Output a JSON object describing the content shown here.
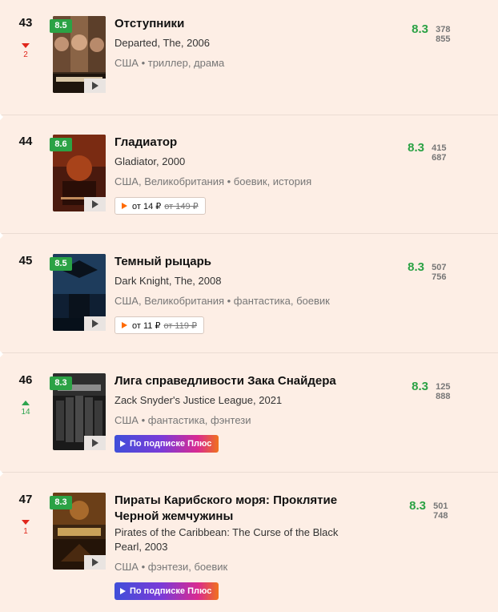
{
  "films": [
    {
      "rank": "43",
      "change": {
        "dir": "down",
        "value": "2"
      },
      "badge": "8.5",
      "title": "Отступники",
      "original": "Departed, The, 2006",
      "meta": "США • триллер, драма",
      "rating": "8.3",
      "votes": "378 855"
    },
    {
      "rank": "44",
      "change": null,
      "badge": "8.6",
      "title": "Гладиатор",
      "original": "Gladiator, 2000",
      "meta": "США, Великобритания • боевик, история",
      "rating": "8.3",
      "votes": "415 687",
      "price": {
        "from": "от 14 ₽",
        "old": "от 149 ₽"
      }
    },
    {
      "rank": "45",
      "change": null,
      "badge": "8.5",
      "title": "Темный рыцарь",
      "original": "Dark Knight, The, 2008",
      "meta": "США, Великобритания • фантастика, боевик",
      "rating": "8.3",
      "votes": "507 756",
      "price": {
        "from": "от 11 ₽",
        "old": "от 119 ₽"
      }
    },
    {
      "rank": "46",
      "change": {
        "dir": "up",
        "value": "14"
      },
      "badge": "8.3",
      "title": "Лига справедливости Зака Снайдера",
      "original": "Zack Snyder's Justice League, 2021",
      "meta": "США • фантастика, фэнтези",
      "rating": "8.3",
      "votes": "125 888",
      "plus": "По подписке Плюс"
    },
    {
      "rank": "47",
      "change": {
        "dir": "down",
        "value": "1"
      },
      "badge": "8.3",
      "title": "Пираты Карибского моря: Проклятие Черной жемчужины",
      "original": "Pirates of the Caribbean: The Curse of the Black Pearl, 2003",
      "meta": "США • фэнтези, боевик",
      "rating": "8.3",
      "votes": "501 748",
      "plus": "По подписке Плюс"
    }
  ],
  "colors": {
    "background": "#fdeee5",
    "rating_green": "#2ba245",
    "down_red": "#e0261b",
    "up_green": "#2da44e",
    "price_orange": "#ff6a00"
  },
  "icons": {
    "play": "play-icon",
    "trend_down": "arrow-down-icon",
    "trend_up": "arrow-up-icon"
  }
}
